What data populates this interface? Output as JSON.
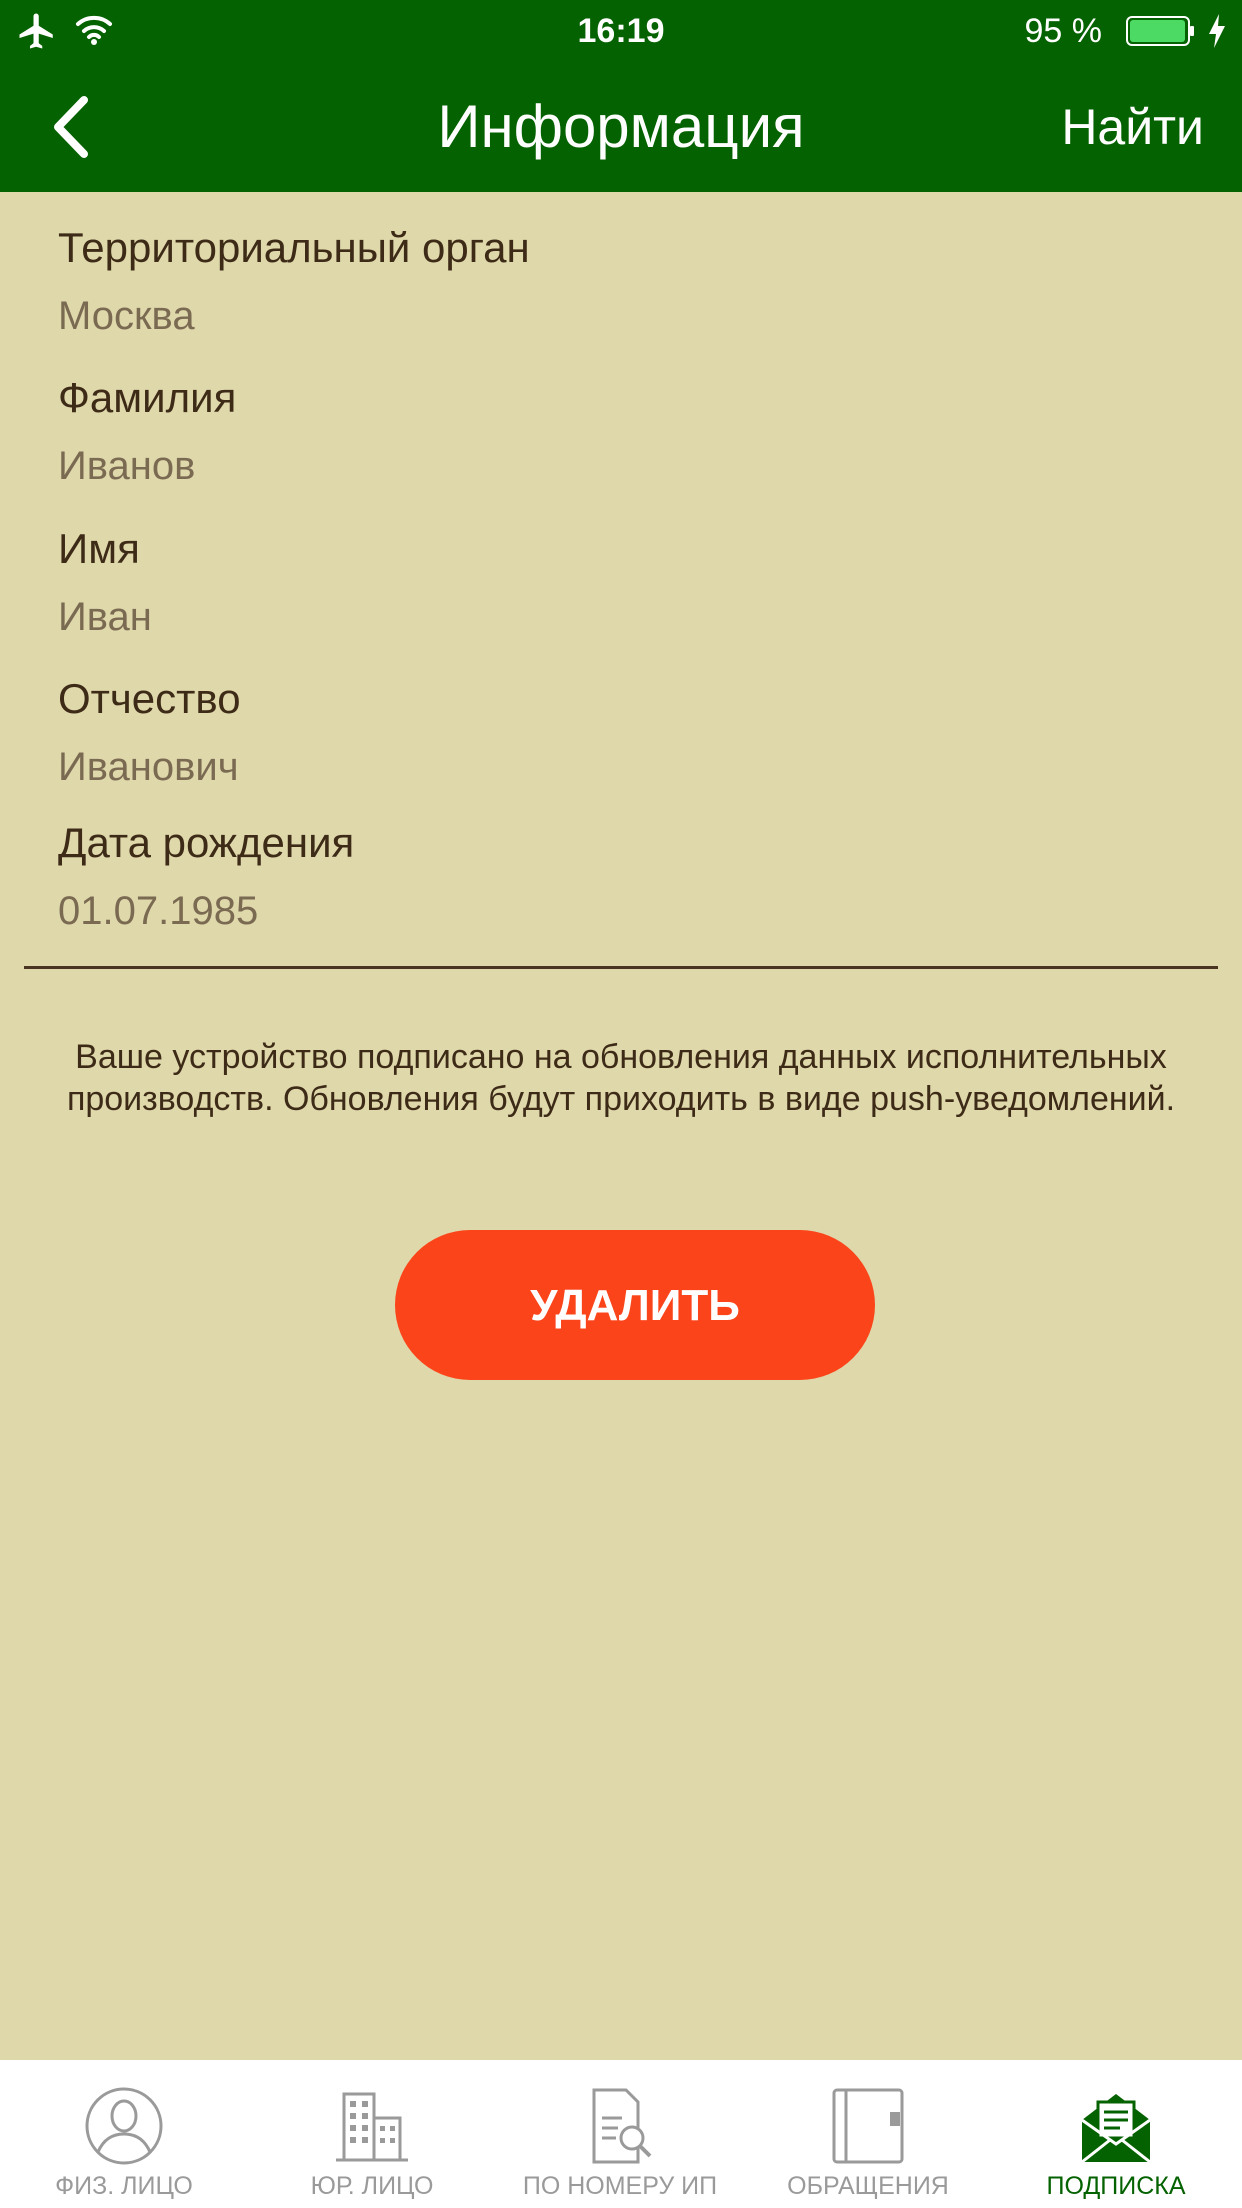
{
  "status_bar": {
    "time": "16:19",
    "battery_percent": "95 %",
    "icons": [
      "airplane-icon",
      "wifi-icon",
      "battery-icon",
      "charging-bolt-icon"
    ]
  },
  "nav": {
    "title": "Информация",
    "search_label": "Найти",
    "back_icon": "chevron-left-icon"
  },
  "fields": [
    {
      "label": "Территориальный орган",
      "value": "Москва"
    },
    {
      "label": "Фамилия",
      "value": "Иванов"
    },
    {
      "label": "Имя",
      "value": "Иван"
    },
    {
      "label": "Отчество",
      "value": "Иванович"
    },
    {
      "label": "Дата рождения",
      "value": "01.07.1985"
    }
  ],
  "notice": "Ваше устройство подписано на обновления данных исполнительных производств. Обновления будут приходить в виде push-уведомлений.",
  "delete_label": "УДАЛИТЬ",
  "tabs": [
    {
      "label": "ФИЗ. ЛИЦО",
      "icon": "person-icon",
      "active": false
    },
    {
      "label": "ЮР. ЛИЦО",
      "icon": "buildings-icon",
      "active": false
    },
    {
      "label": "ПО НОМЕРУ ИП",
      "icon": "document-search-icon",
      "active": false
    },
    {
      "label": "ОБРАЩЕНИЯ",
      "icon": "book-icon",
      "active": false
    },
    {
      "label": "ПОДПИСКА",
      "icon": "envelope-icon",
      "active": true
    }
  ],
  "colors": {
    "header": "#046200",
    "background": "#dfd8ab",
    "accent_button": "#fc441a",
    "tab_active": "#046200",
    "tab_inactive": "#9a9a9a",
    "battery_fill": "#4cd964"
  }
}
